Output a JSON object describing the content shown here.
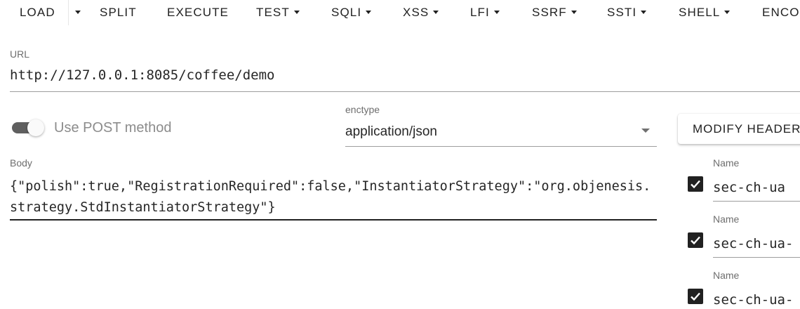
{
  "toolbar": {
    "load": "LOAD",
    "split": "SPLIT",
    "execute": "EXECUTE",
    "test": "TEST",
    "sqli": "SQLI",
    "xss": "XSS",
    "lfi": "LFI",
    "ssrf": "SSRF",
    "ssti": "SSTI",
    "shell": "SHELL",
    "encode": "ENCO"
  },
  "url": {
    "label": "URL",
    "value": "http://127.0.0.1:8085/coffee/demo"
  },
  "post_toggle": {
    "label": "Use POST method",
    "checked": true
  },
  "enctype": {
    "label": "enctype",
    "value": "application/json"
  },
  "body": {
    "label": "Body",
    "value": "{\"polish\":true,\"RegistrationRequired\":false,\"InstantiatorStrategy\":\"org.objenesis.strategy.StdInstantiatorStrategy\"}"
  },
  "modify_headers": {
    "label": "MODIFY HEADER"
  },
  "headers": [
    {
      "name_label": "Name",
      "name_value": "sec-ch-ua",
      "enabled": true
    },
    {
      "name_label": "Name",
      "name_value": "sec-ch-ua-",
      "enabled": true
    },
    {
      "name_label": "Name",
      "name_value": "sec-ch-ua-",
      "enabled": true
    }
  ],
  "colors": {
    "text": "#212121",
    "label": "#6e6e6e",
    "toggle_track": "#5f5f5f",
    "checkbox": "#212121"
  }
}
